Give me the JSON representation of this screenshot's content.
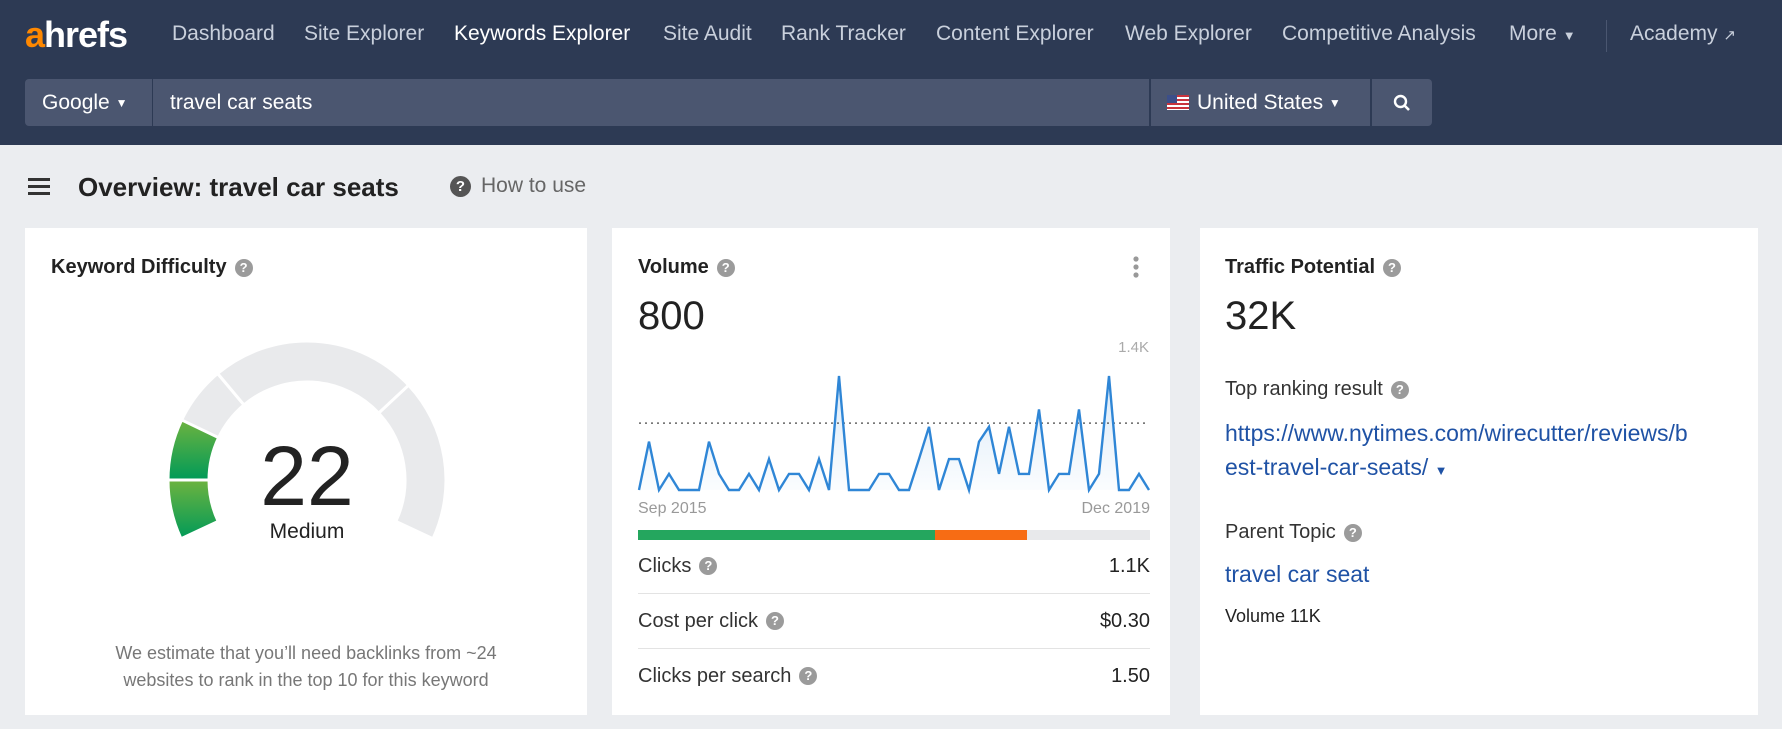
{
  "header": {
    "logo": "ahrefs",
    "nav": [
      "Dashboard",
      "Site Explorer",
      "Keywords Explorer",
      "Site Audit",
      "Rank Tracker",
      "Content Explorer",
      "Web Explorer",
      "Competitive Analysis",
      "More"
    ],
    "active_nav": "Keywords Explorer",
    "academy": "Academy",
    "search": {
      "engine": "Google",
      "query": "travel car seats",
      "country": "United States"
    }
  },
  "page": {
    "title": "Overview: travel car seats",
    "how_to_use": "How to use"
  },
  "kd": {
    "title": "Keyword Difficulty",
    "value": "22",
    "value_num": 22,
    "max": 100,
    "label": "Medium",
    "note_1": "We estimate that you’ll need backlinks from ~24",
    "note_2": "websites to rank in the top 10 for this keyword",
    "color": "#2aa24a"
  },
  "volume": {
    "title": "Volume",
    "value": "800",
    "bar": {
      "green_fraction": 0.58,
      "orange_fraction": 0.18,
      "colors": {
        "green": "#24a65e",
        "orange": "#f76c14",
        "gray": "#e8e9eb"
      }
    },
    "rows": [
      {
        "label": "Clicks",
        "value": "1.1K"
      },
      {
        "label": "Cost per click",
        "value": "$0.30"
      },
      {
        "label": "Clicks per search",
        "value": "1.50"
      }
    ]
  },
  "chart_data": {
    "type": "area",
    "x_start": "Sep 2015",
    "x_end": "Dec 2019",
    "y_max_label": "1.4K",
    "ylim": [
      0,
      1400
    ],
    "reference_line": 800,
    "color": "#2f86d6",
    "values": [
      260,
      650,
      260,
      390,
      260,
      260,
      260,
      650,
      390,
      260,
      260,
      390,
      260,
      510,
      260,
      390,
      390,
      260,
      510,
      260,
      1180,
      260,
      260,
      260,
      390,
      390,
      260,
      260,
      510,
      770,
      260,
      510,
      510,
      260,
      650,
      770,
      390,
      770,
      390,
      390,
      910,
      260,
      390,
      390,
      910,
      260,
      390,
      1180,
      260,
      260,
      390,
      260
    ]
  },
  "traffic": {
    "title": "Traffic Potential",
    "value": "32K",
    "top_label": "Top ranking result",
    "url_1": "https://www.nytimes.com/wirecutter/reviews/b",
    "url_2": "est-travel-car-seats/",
    "parent_label": "Parent Topic",
    "parent": "travel car seat",
    "parent_volume": "Volume 11K"
  }
}
